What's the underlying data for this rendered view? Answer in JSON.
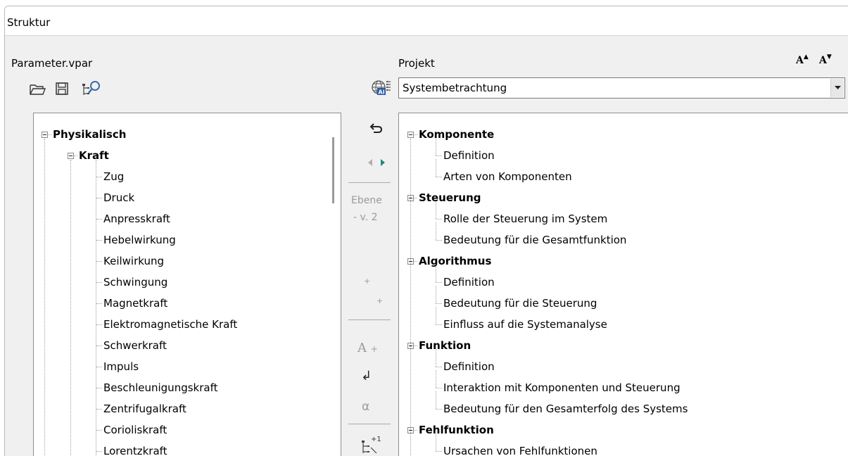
{
  "window": {
    "title": "Struktur"
  },
  "left": {
    "header": "Parameter.vpar",
    "tree": [
      {
        "label": "Physikalisch",
        "level": 0,
        "bold": true,
        "expander": true
      },
      {
        "label": "Kraft",
        "level": 1,
        "bold": true,
        "expander": true
      },
      {
        "label": "Zug",
        "level": 2
      },
      {
        "label": "Druck",
        "level": 2
      },
      {
        "label": "Anpresskraft",
        "level": 2
      },
      {
        "label": "Hebelwirkung",
        "level": 2
      },
      {
        "label": "Keilwirkung",
        "level": 2
      },
      {
        "label": "Schwingung",
        "level": 2
      },
      {
        "label": "Magnetkraft",
        "level": 2
      },
      {
        "label": "Elektromagnetische Kraft",
        "level": 2
      },
      {
        "label": "Schwerkraft",
        "level": 2
      },
      {
        "label": "Impuls",
        "level": 2
      },
      {
        "label": "Beschleunigungskraft",
        "level": 2
      },
      {
        "label": "Zentrifugalkraft",
        "level": 2
      },
      {
        "label": "Corioliskraft",
        "level": 2
      },
      {
        "label": "Lorentzkraft",
        "level": 2
      }
    ]
  },
  "middle": {
    "ebene_line1": "Ebene",
    "ebene_line2": "- v. 2",
    "plus1": "+",
    "plus2": "+",
    "font_A": "A",
    "font_plus": "+",
    "alpha": "α",
    "return_glyph": "↲",
    "level_icon_sup": "+1"
  },
  "right": {
    "header": "Projekt",
    "font_larger": "A",
    "font_smaller": "A",
    "combo_value": "Systembetrachtung",
    "tree": [
      {
        "label": "Komponente",
        "level": 0,
        "bold": true,
        "expander": true
      },
      {
        "label": "Definition",
        "level": 1
      },
      {
        "label": "Arten von Komponenten",
        "level": 1,
        "last": true
      },
      {
        "label": "Steuerung",
        "level": 0,
        "bold": true,
        "expander": true
      },
      {
        "label": "Rolle der Steuerung im System",
        "level": 1
      },
      {
        "label": "Bedeutung für die Gesamtfunktion",
        "level": 1,
        "last": true
      },
      {
        "label": "Algorithmus",
        "level": 0,
        "bold": true,
        "expander": true
      },
      {
        "label": "Definition",
        "level": 1
      },
      {
        "label": "Bedeutung für die Steuerung",
        "level": 1
      },
      {
        "label": "Einfluss auf die Systemanalyse",
        "level": 1,
        "last": true
      },
      {
        "label": "Funktion",
        "level": 0,
        "bold": true,
        "expander": true
      },
      {
        "label": "Definition",
        "level": 1
      },
      {
        "label": "Interaktion mit Komponenten und Steuerung",
        "level": 1
      },
      {
        "label": "Bedeutung für den Gesamterfolg des Systems",
        "level": 1,
        "last": true
      },
      {
        "label": "Fehlfunktion",
        "level": 0,
        "bold": true,
        "expander": true
      },
      {
        "label": "Ursachen von Fehlfunktionen",
        "level": 1
      }
    ]
  },
  "colors": {
    "accent_teal": "#1c8a7a",
    "icon_blue": "#2a5aa8",
    "disabled_gray": "#9a9a9a"
  }
}
